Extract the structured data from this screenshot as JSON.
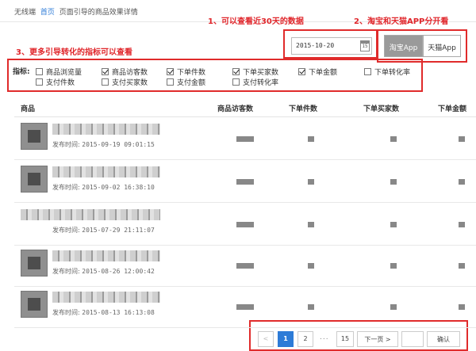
{
  "breadcrumb": {
    "root": "无线端",
    "home": "首页",
    "current": "页面引导的商品效果详情"
  },
  "annotations": {
    "a1": "1、可以查看近30天的数据",
    "a2": "2、淘宝和天猫APP分开看",
    "a3": "3、更多引导转化的指标可以查看"
  },
  "date": {
    "value": "2015-10-20",
    "cal_icon": "calendar-icon",
    "cal_text": "15"
  },
  "app_toggle": {
    "taobao": "淘宝App",
    "tmall": "天猫App",
    "selected": "taobao"
  },
  "metrics": {
    "label": "指标:",
    "items": [
      {
        "label": "商品浏览量",
        "checked": false
      },
      {
        "label": "商品访客数",
        "checked": true
      },
      {
        "label": "下单件数",
        "checked": true
      },
      {
        "label": "下单买家数",
        "checked": true
      },
      {
        "label": "下单金额",
        "checked": true
      },
      {
        "label": "下单转化率",
        "checked": false
      },
      {
        "label": "支付件数",
        "checked": false
      },
      {
        "label": "支付买家数",
        "checked": false
      },
      {
        "label": "支付金额",
        "checked": false
      },
      {
        "label": "支付转化率",
        "checked": false
      }
    ]
  },
  "table": {
    "headers": [
      "商品",
      "商品访客数",
      "下单件数",
      "下单买家数",
      "下单金额"
    ],
    "pub_label": "发布时间:",
    "rows": [
      {
        "time": "2015-09-19 09:01:15"
      },
      {
        "time": "2015-09-02 16:38:10"
      },
      {
        "time": "2015-07-29 21:11:07"
      },
      {
        "time": "2015-08-26 12:00:42"
      },
      {
        "time": "2015-08-13 16:13:08"
      }
    ]
  },
  "pager": {
    "prev": "<",
    "pages": [
      "1",
      "2",
      "15"
    ],
    "dots": "...",
    "next": "下一页 >",
    "confirm": "确认",
    "current": "1"
  }
}
